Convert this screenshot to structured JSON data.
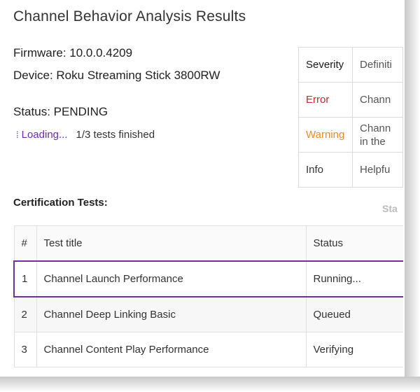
{
  "header": {
    "title": "Channel Behavior Analysis Results"
  },
  "meta": {
    "firmware": "Firmware: 10.0.0.4209",
    "device": "Device: Roku Streaming Stick 3800RW",
    "status": "Status: PENDING"
  },
  "loading": {
    "label": "Loading...",
    "progress": "1/3 tests finished"
  },
  "severity_table": {
    "header": [
      "Severity",
      "Definiti"
    ],
    "rows": [
      {
        "severity": "Error",
        "definition": "Chann"
      },
      {
        "severity": "Warning",
        "definition": "Chann in the"
      },
      {
        "severity": "Info",
        "definition": "Helpfu"
      }
    ]
  },
  "tests": {
    "section_title": "Certification Tests:",
    "status_header_cut": "Sta",
    "columns": [
      "#",
      "Test title",
      "Status"
    ],
    "rows": [
      {
        "num": "1",
        "title": "Channel Launch Performance",
        "status": "Running..."
      },
      {
        "num": "2",
        "title": "Channel Deep Linking Basic",
        "status": "Queued"
      },
      {
        "num": "3",
        "title": "Channel Content Play Performance",
        "status": "Verifying"
      }
    ]
  },
  "colors": {
    "accent": "#6f2da8",
    "error": "#d0262f",
    "warning": "#f08a24"
  }
}
